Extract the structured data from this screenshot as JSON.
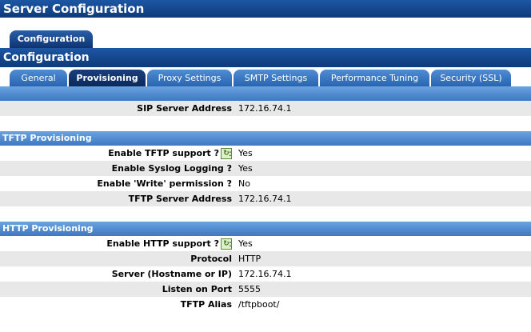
{
  "window": {
    "title": "Server Configuration"
  },
  "outer_tab": {
    "label": "Configuration"
  },
  "section_title": "Configuration",
  "tabs": [
    {
      "label": "General",
      "active": false
    },
    {
      "label": "Provisioning",
      "active": true
    },
    {
      "label": "Proxy Settings",
      "active": false
    },
    {
      "label": "SMTP Settings",
      "active": false
    },
    {
      "label": "Performance Tuning",
      "active": false
    },
    {
      "label": "Security (SSL)",
      "active": false
    }
  ],
  "sip": {
    "label": "SIP Server Address",
    "value": "172.16.74.1"
  },
  "tftp": {
    "header": "TFTP Provisioning",
    "rows": [
      {
        "label": "Enable TFTP support ?",
        "value": "Yes",
        "help_icon": "help-refresh-icon"
      },
      {
        "label": "Enable Syslog Logging ?",
        "value": "Yes"
      },
      {
        "label": "Enable 'Write' permission ?",
        "value": "No"
      },
      {
        "label": "TFTP Server Address",
        "value": "172.16.74.1"
      }
    ]
  },
  "http": {
    "header": "HTTP Provisioning",
    "rows": [
      {
        "label": "Enable HTTP support ?",
        "value": "Yes",
        "help_icon": "help-refresh-icon"
      },
      {
        "label": "Protocol",
        "value": "HTTP"
      },
      {
        "label": "Server (Hostname or IP)",
        "value": "172.16.74.1"
      },
      {
        "label": "Listen on Port",
        "value": "5555"
      },
      {
        "label": "TFTP Alias",
        "value": "/tftpboot/"
      }
    ]
  },
  "colon": ":"
}
